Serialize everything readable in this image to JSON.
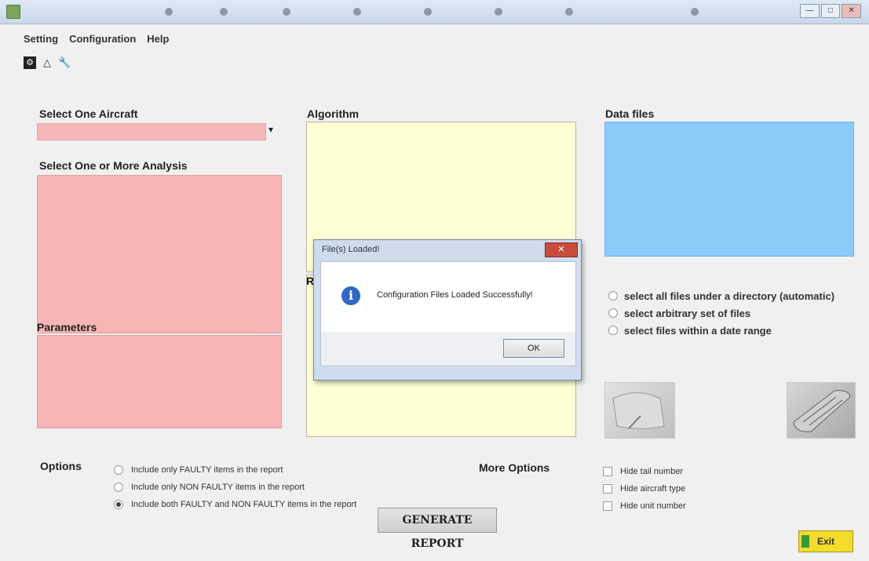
{
  "titlebar": {
    "controls": {
      "min": "—",
      "max": "□",
      "close": "✕"
    }
  },
  "menu": {
    "items": [
      "Setting",
      "Configuration",
      "Help"
    ]
  },
  "toolbar": {
    "icons": [
      "settings-icon",
      "warning-icon",
      "wrench-icon"
    ]
  },
  "left": {
    "aircraft_label": "Select One Aircraft",
    "aircraft_value": "",
    "analysis_label": "Select One or More Analysis",
    "parameters_label": "Parameters"
  },
  "middle": {
    "algorithm_label": "Algorithm",
    "results_label_partial": "R"
  },
  "right": {
    "datafiles_label": "Data files",
    "file_modes": [
      "select all files under a directory (automatic)",
      "select arbitrary set of files",
      "select files within a date range"
    ]
  },
  "options": {
    "label": "Options",
    "items": [
      "Include only FAULTY items in the report",
      "Include only NON FAULTY items in the report",
      "Include both FAULTY and NON FAULTY items in the report"
    ],
    "selected_index": 2
  },
  "more_options": {
    "label": "More Options",
    "items": [
      "Hide tail number",
      "Hide aircraft type",
      "Hide unit number"
    ]
  },
  "buttons": {
    "generate": "GENERATE REPORT",
    "exit": "Exit"
  },
  "dialog": {
    "title": "File(s) Loaded!",
    "message": "Configuration Files Loaded Successfully!",
    "ok": "OK",
    "close": "✕"
  },
  "colors": {
    "aircraft_panel": "#f7b5b5",
    "algorithm_panel": "#ffffd6",
    "datafiles_panel": "#8ccafa",
    "exit_button": "#f3dc2a"
  }
}
